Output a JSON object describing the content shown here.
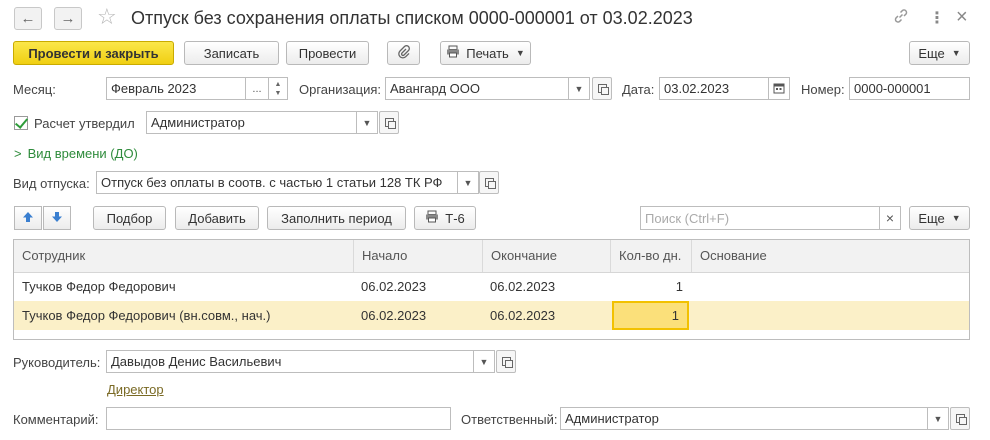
{
  "window": {
    "title": "Отпуск без сохранения оплаты списком 0000-000001 от 03.02.2023",
    "back_icon": "←",
    "forward_icon": "→",
    "star_icon": "☆",
    "link_icon": "🔗",
    "more_icon": "⋮",
    "close_icon": "×"
  },
  "toolbar": {
    "post_close": "Провести и закрыть",
    "save": "Записать",
    "post": "Провести",
    "print": "Печать",
    "more": "Еще"
  },
  "form": {
    "month_label": "Месяц:",
    "month_value": "Февраль 2023",
    "month_choose": "...",
    "org_label": "Организация:",
    "org_value": "Авангард ООО",
    "date_label": "Дата:",
    "date_value": "03.02.2023",
    "number_label": "Номер:",
    "number_value": "0000-000001",
    "approved_label": "Расчет утвердил",
    "approved_value": "Администратор",
    "time_type_label": "Вид времени (ДО)",
    "leave_type_label": "Вид отпуска:",
    "leave_type_value": "Отпуск без оплаты в соотв. с частью 1 статьи 128 ТК РФ"
  },
  "table_toolbar": {
    "pick": "Подбор",
    "add": "Добавить",
    "fill_period": "Заполнить период",
    "t6": "Т-6",
    "search_placeholder": "Поиск (Ctrl+F)",
    "clear": "×",
    "more": "Еще"
  },
  "table": {
    "columns": [
      "Сотрудник",
      "Начало",
      "Окончание",
      "Кол-во дн.",
      "Основание"
    ],
    "rows": [
      {
        "employee": "Тучков Федор Федорович",
        "start": "06.02.2023",
        "end": "06.02.2023",
        "days": "1",
        "basis": ""
      },
      {
        "employee": "Тучков Федор Федорович (вн.совм., нач.)",
        "start": "06.02.2023",
        "end": "06.02.2023",
        "days": "1",
        "basis": ""
      }
    ]
  },
  "footer": {
    "head_label": "Руководитель:",
    "head_value": "Давыдов Денис Васильевич",
    "head_position": "Директор",
    "comment_label": "Комментарий:",
    "comment_value": "",
    "responsible_label": "Ответственный:",
    "responsible_value": "Администратор"
  },
  "colors": {
    "primary_button": "#f0cf12",
    "selected_row": "#fbf0c8",
    "focused_cell": "#fbe07a",
    "link_green": "#2e8b3b",
    "arrow_blue": "#3a7fd0"
  }
}
